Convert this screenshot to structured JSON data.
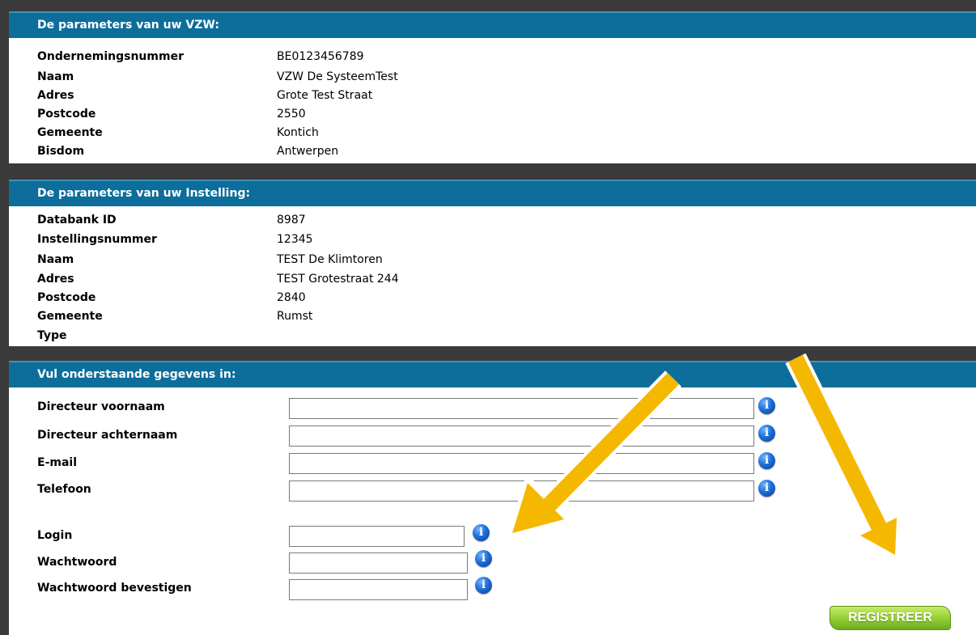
{
  "vzw": {
    "header": "De parameters van uw VZW:",
    "rows": [
      {
        "label": "Ondernemingsnummer",
        "value": "BE0123456789"
      },
      {
        "label": "Naam",
        "value": "VZW De SysteemTest"
      },
      {
        "label": "Adres",
        "value": "Grote Test Straat"
      },
      {
        "label": "Postcode",
        "value": "2550"
      },
      {
        "label": "Gemeente",
        "value": "Kontich"
      },
      {
        "label": "Bisdom",
        "value": "Antwerpen"
      }
    ]
  },
  "instelling": {
    "header": "De parameters van uw Instelling:",
    "rows": [
      {
        "label": "Databank ID",
        "value": "8987"
      },
      {
        "label": "Instellingsnummer",
        "value": "12345"
      },
      {
        "label": "Naam",
        "value": "TEST De Klimtoren"
      },
      {
        "label": "Adres",
        "value": "TEST Grotestraat 244"
      },
      {
        "label": "Postcode",
        "value": "2840"
      },
      {
        "label": "Gemeente",
        "value": "Rumst"
      },
      {
        "label": "Type",
        "value": ""
      }
    ]
  },
  "form": {
    "header": "Vul onderstaande gegevens in:",
    "fields": [
      {
        "label": "Directeur voornaam",
        "value": ""
      },
      {
        "label": "Directeur achternaam",
        "value": ""
      },
      {
        "label": "E-mail",
        "value": ""
      },
      {
        "label": "Telefoon",
        "value": ""
      },
      {
        "label": "Login",
        "value": ""
      },
      {
        "label": "Wachtwoord",
        "value": ""
      },
      {
        "label": "Wachtwoord bevestigen",
        "value": ""
      }
    ],
    "info_glyph": "i",
    "info_icon": "info-circle-icon",
    "submit_label": "REGISTREER"
  },
  "colors": {
    "header_bg": "#0d6d9b",
    "dark_bar": "#3a3a3a",
    "button_green": "#9bd33c",
    "arrow": "#f5b800"
  },
  "annotations": {
    "arrows": 2,
    "arrow_icon": "yellow-arrow-icon"
  }
}
